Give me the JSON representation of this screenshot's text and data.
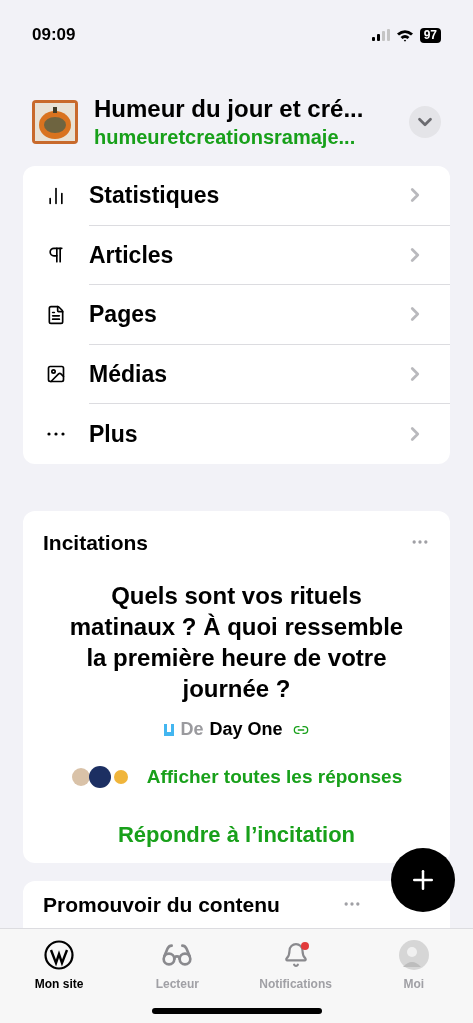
{
  "status_bar": {
    "time": "09:09",
    "battery": "97"
  },
  "site": {
    "title": "Humeur du jour et cré...",
    "url": "humeuretcreationsramaje..."
  },
  "menu": [
    {
      "kind": "stats",
      "label": "Statistiques"
    },
    {
      "kind": "posts",
      "label": "Articles"
    },
    {
      "kind": "pages",
      "label": "Pages"
    },
    {
      "kind": "media",
      "label": "Médias"
    },
    {
      "kind": "more",
      "label": "Plus"
    }
  ],
  "prompt_card": {
    "title": "Incitations",
    "question": "Quels sont vos rituels matinaux ? À quoi ressemble la première heure de votre journée ?",
    "source_prefix": "De",
    "source": "Day One",
    "answers_link": "Afficher toutes les réponses",
    "answer_button": "Répondre à l’incitation"
  },
  "next_card": {
    "title": "Promouvoir du contenu"
  },
  "tabs": [
    {
      "kind": "site",
      "label": "Mon site",
      "selected": true
    },
    {
      "kind": "reader",
      "label": "Lecteur",
      "selected": false
    },
    {
      "kind": "notifications",
      "label": "Notifications",
      "selected": false,
      "badge": true
    },
    {
      "kind": "me",
      "label": "Moi",
      "selected": false
    }
  ]
}
